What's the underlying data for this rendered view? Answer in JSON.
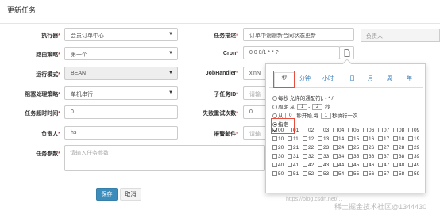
{
  "modal": {
    "title": "更新任务"
  },
  "background": {
    "right_field_placeholder": "负责人"
  },
  "form": {
    "executor": {
      "label": "执行器",
      "required": "*",
      "value": "会员订单中心"
    },
    "route": {
      "label": "路由策略",
      "required": "*",
      "value": "第一个"
    },
    "run_mode": {
      "label": "运行模式",
      "required": "*",
      "value": "BEAN"
    },
    "block": {
      "label": "阻塞处理策略",
      "required": "*",
      "value": "单机串行"
    },
    "timeout": {
      "label": "任务超时时间",
      "required": "*",
      "value": "0"
    },
    "owner": {
      "label": "负责人",
      "required": "*",
      "value": "hs"
    },
    "params": {
      "label": "任务参数",
      "required": "*",
      "placeholder": "请输入任务参数"
    },
    "desc": {
      "label": "任务描述",
      "required": "*",
      "value": "订单中谢谢新合同状态更新"
    },
    "cron": {
      "label": "Cron",
      "required": "*",
      "value": "0 0 0/1 * * ?"
    },
    "handler": {
      "label": "JobHandler",
      "required": "*",
      "value": "xinN"
    },
    "child": {
      "label": "子任务ID",
      "required": "*",
      "placeholder": "请输"
    },
    "retry": {
      "label": "失败重试次数",
      "required": "*",
      "value": "0"
    },
    "alarm": {
      "label": "报警邮件",
      "required": "*",
      "placeholder": "请输"
    }
  },
  "buttons": {
    "save": "保存",
    "cancel": "取消"
  },
  "cron_popover": {
    "tabs": [
      "秒",
      "分钟",
      "小时",
      "日",
      "月",
      "周",
      "年"
    ],
    "active_tab": "秒",
    "opt_every": "每秒 允许的通配符[, - * /]",
    "opt_cycle_pre": "周期 从",
    "opt_cycle_from": "1",
    "opt_cycle_dash": "-",
    "opt_cycle_to": "2",
    "opt_cycle_unit": "秒",
    "opt_from_pre": "从",
    "opt_from_start": "0",
    "opt_from_mid": "秒开始,每",
    "opt_from_step": "1",
    "opt_from_post": "秒执行一次",
    "opt_specify": "指定",
    "seconds": [
      "00",
      "01",
      "02",
      "03",
      "04",
      "05",
      "06",
      "07",
      "08",
      "09",
      "10",
      "11",
      "12",
      "13",
      "14",
      "15",
      "16",
      "17",
      "18",
      "19",
      "20",
      "21",
      "22",
      "23",
      "24",
      "25",
      "26",
      "27",
      "28",
      "29",
      "30",
      "31",
      "32",
      "33",
      "34",
      "35",
      "36",
      "37",
      "38",
      "39",
      "40",
      "41",
      "42",
      "43",
      "44",
      "45",
      "46",
      "47",
      "48",
      "49",
      "50",
      "51",
      "52",
      "53",
      "54",
      "55",
      "56",
      "57",
      "58",
      "59"
    ],
    "checked": [
      "00"
    ]
  },
  "watermark": {
    "url": "https://blog.csdn.net/...",
    "brand": "稀土掘金技术社区",
    "handle": "@1344430"
  },
  "colors": {
    "primary": "#3c8dbc",
    "required": "#c0392b",
    "highlight": "#e74c3c",
    "link": "#337ab7"
  }
}
